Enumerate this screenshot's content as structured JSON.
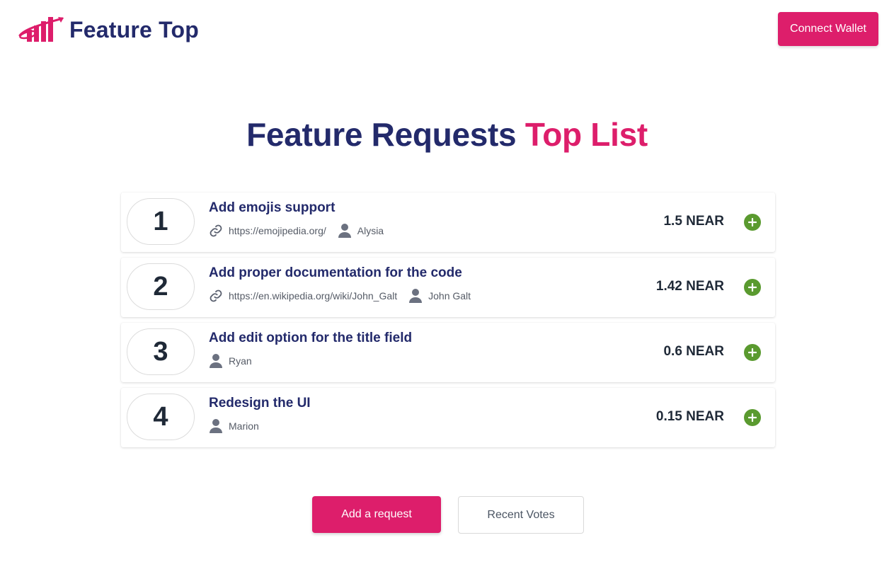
{
  "app": {
    "name": "Feature Top",
    "logo_icon": "bar-chart-rocket-logo"
  },
  "header": {
    "connect_label": "Connect Wallet"
  },
  "hero": {
    "title_part1": "Feature Requests",
    "title_part2": "Top List"
  },
  "colors": {
    "brand_pink": "#dd1e6b",
    "brand_navy": "#232a6b",
    "vote_green": "#5a9a2f"
  },
  "requests": [
    {
      "rank": "1",
      "title": "Add emojis support",
      "link": "https://emojipedia.org/",
      "user": "Alysia",
      "amount": "1.5 NEAR"
    },
    {
      "rank": "2",
      "title": "Add proper documentation for the code",
      "link": "https://en.wikipedia.org/wiki/John_Galt",
      "user": "John Galt",
      "amount": "1.42 NEAR"
    },
    {
      "rank": "3",
      "title": "Add edit option for the title field",
      "user": "Ryan",
      "amount": "0.6 NEAR"
    },
    {
      "rank": "4",
      "title": "Redesign the UI",
      "user": "Marion",
      "amount": "0.15 NEAR"
    }
  ],
  "actions": {
    "add_label": "Add a request",
    "recent_label": "Recent Votes"
  }
}
